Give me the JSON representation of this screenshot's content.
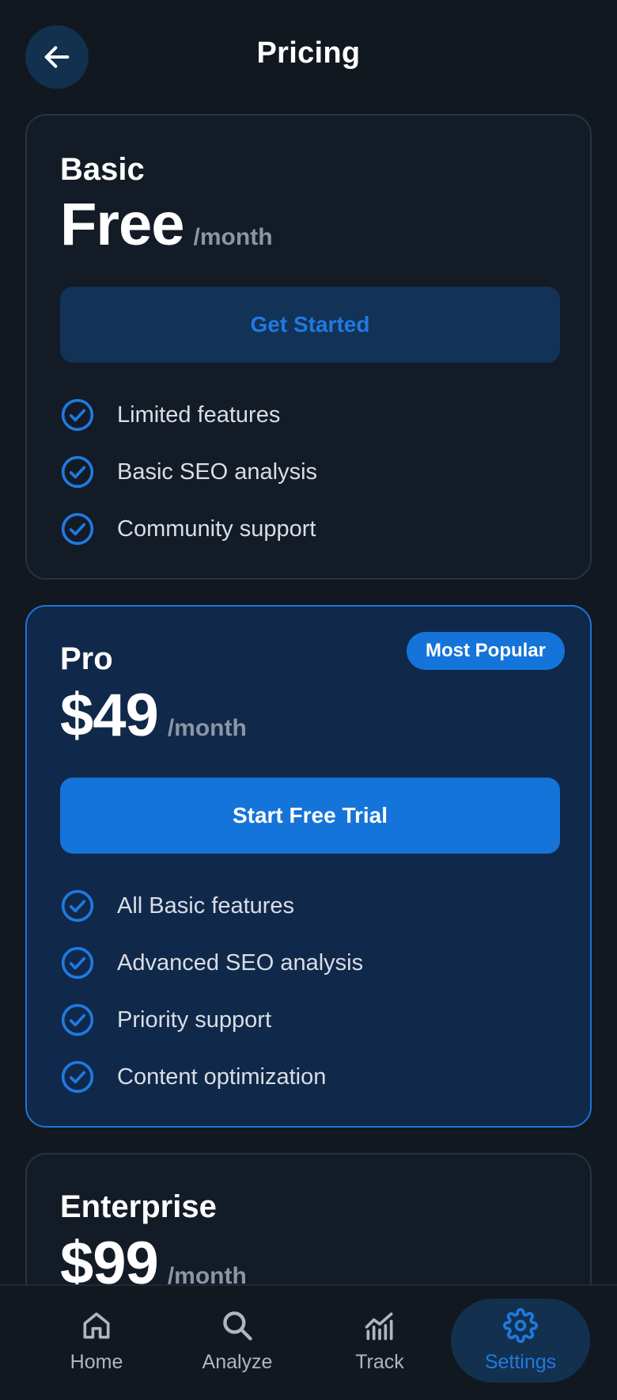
{
  "header": {
    "title": "Pricing",
    "back_icon": "arrow-left-icon"
  },
  "plans": [
    {
      "name": "Basic",
      "price": "Free",
      "period": "/month",
      "cta": "Get Started",
      "features": [
        "Limited features",
        "Basic SEO analysis",
        "Community support"
      ]
    },
    {
      "name": "Pro",
      "price": "$49",
      "period": "/month",
      "badge": "Most Popular",
      "cta": "Start Free Trial",
      "features": [
        "All Basic features",
        "Advanced SEO analysis",
        "Priority support",
        "Content optimization"
      ]
    },
    {
      "name": "Enterprise",
      "price": "$99",
      "period": "/month"
    }
  ],
  "nav": {
    "items": [
      {
        "label": "Home",
        "icon": "home-icon"
      },
      {
        "label": "Analyze",
        "icon": "search-icon"
      },
      {
        "label": "Track",
        "icon": "chart-icon"
      },
      {
        "label": "Settings",
        "icon": "gear-icon",
        "active": true
      }
    ]
  },
  "colors": {
    "background": "#111820",
    "card": "#131b26",
    "featured_card": "#10284a",
    "accent": "#1474da",
    "accent_text": "#1f7ae0",
    "muted": "#8b96a5"
  }
}
